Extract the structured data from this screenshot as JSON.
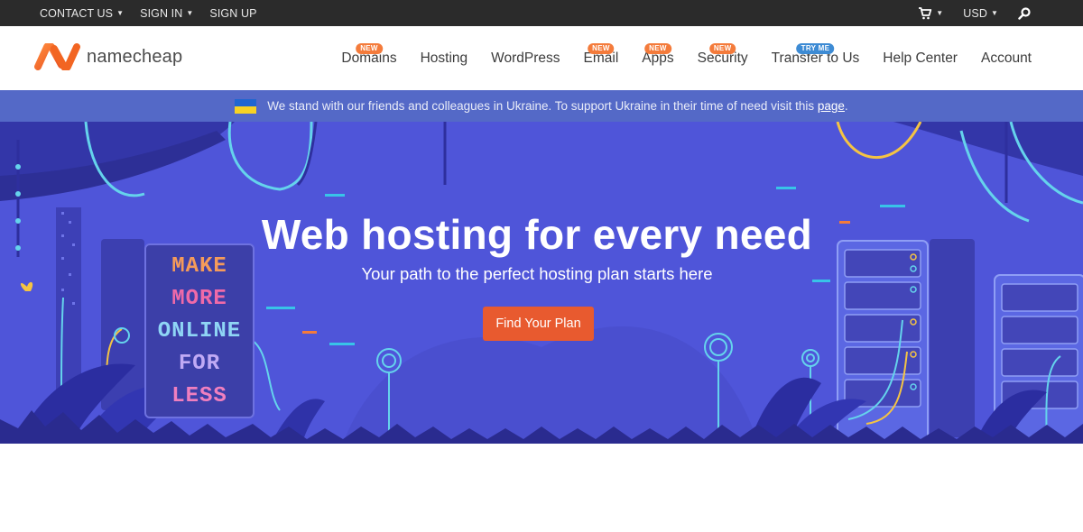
{
  "topbar": {
    "contact_label": "CONTACT US",
    "signin_label": "SIGN IN",
    "signup_label": "SIGN UP",
    "currency_label": "USD"
  },
  "header": {
    "logo_text": "namecheap",
    "nav": [
      {
        "label": "Domains",
        "badge": "NEW"
      },
      {
        "label": "Hosting",
        "badge": ""
      },
      {
        "label": "WordPress",
        "badge": ""
      },
      {
        "label": "Email",
        "badge": "NEW"
      },
      {
        "label": "Apps",
        "badge": "NEW"
      },
      {
        "label": "Security",
        "badge": "NEW"
      },
      {
        "label": "Transfer to Us",
        "badge": "TRY ME"
      },
      {
        "label": "Help Center",
        "badge": ""
      },
      {
        "label": "Account",
        "badge": ""
      }
    ]
  },
  "banner": {
    "text": "We stand with our friends and colleagues in Ukraine. To support Ukraine in their time of need visit this",
    "link": "page",
    "end": "."
  },
  "hero": {
    "title": "Web hosting for every need",
    "subtitle": "Your path to the perfect hosting plan starts here",
    "cta": "Find Your Plan",
    "sign_lines": [
      "MAKE",
      "MORE",
      "ONLINE",
      "FOR",
      "LESS"
    ]
  },
  "colors": {
    "topbar": "#2b2b2b",
    "banner": "#5469c7",
    "hero_bg": "#4f55d9",
    "cta": "#e85a2f",
    "badge_new": "#f47b3b",
    "badge_try": "#3d8bd4"
  }
}
